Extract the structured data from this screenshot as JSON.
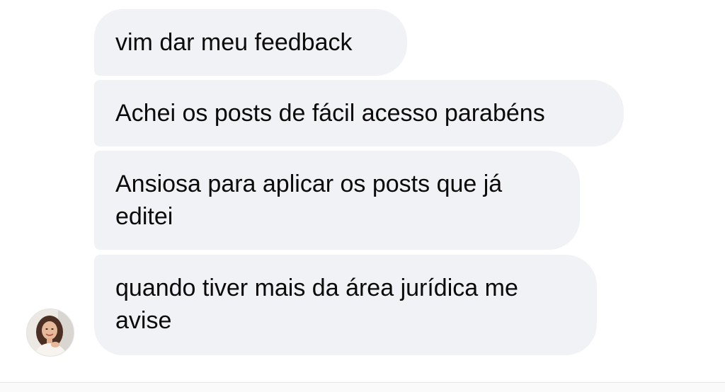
{
  "messages": [
    {
      "lines": [
        "vim dar meu feedback"
      ]
    },
    {
      "lines": [
        "Achei os posts de fácil acesso parabéns"
      ]
    },
    {
      "lines": [
        "Ansiosa para aplicar os posts que já",
        "editei"
      ]
    },
    {
      "lines": [
        "quando tiver mais da área jurídica me",
        "avise"
      ]
    }
  ],
  "sender": {
    "avatar_icon": "profile-photo"
  },
  "colors": {
    "bubble": "#f1f2f5",
    "text": "#0b0b0b",
    "background": "#ffffff"
  }
}
